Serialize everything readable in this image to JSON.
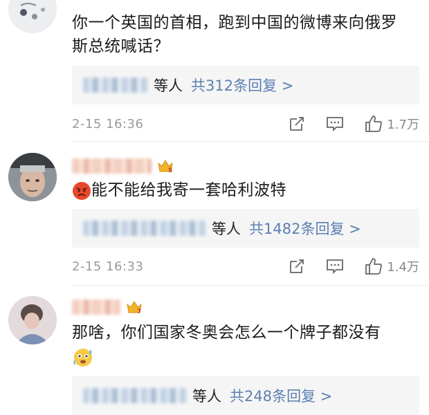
{
  "comments": [
    {
      "text_line1": "你一个英国的首相，跑到中国的微博来向俄罗",
      "text_line2": "斯总统喊话？",
      "reply_deng": "等人",
      "reply_link": "共312条回复 >",
      "time": "2-15 16:36",
      "likes": "1.7万"
    },
    {
      "emoji": "angry-face-emoji",
      "text": "能不能给我寄一套哈利波特",
      "badge_level": "5",
      "reply_deng": "等人",
      "reply_link": "共1482条回复 >",
      "time": "2-15 16:33",
      "likes": "1.4万"
    },
    {
      "text_line1": "那啥，你们国家冬奥会怎么一个牌子都没有",
      "emoji": "nervous-sweat-emoji",
      "badge_level": "7",
      "reply_deng": "等人",
      "reply_link": "共248条回复 >"
    }
  ],
  "colors": {
    "link": "#5b7fb3",
    "reply_bg": "#f5f5f5",
    "meta_text": "#9a9a9a",
    "badge_gold": "#f0b429"
  }
}
